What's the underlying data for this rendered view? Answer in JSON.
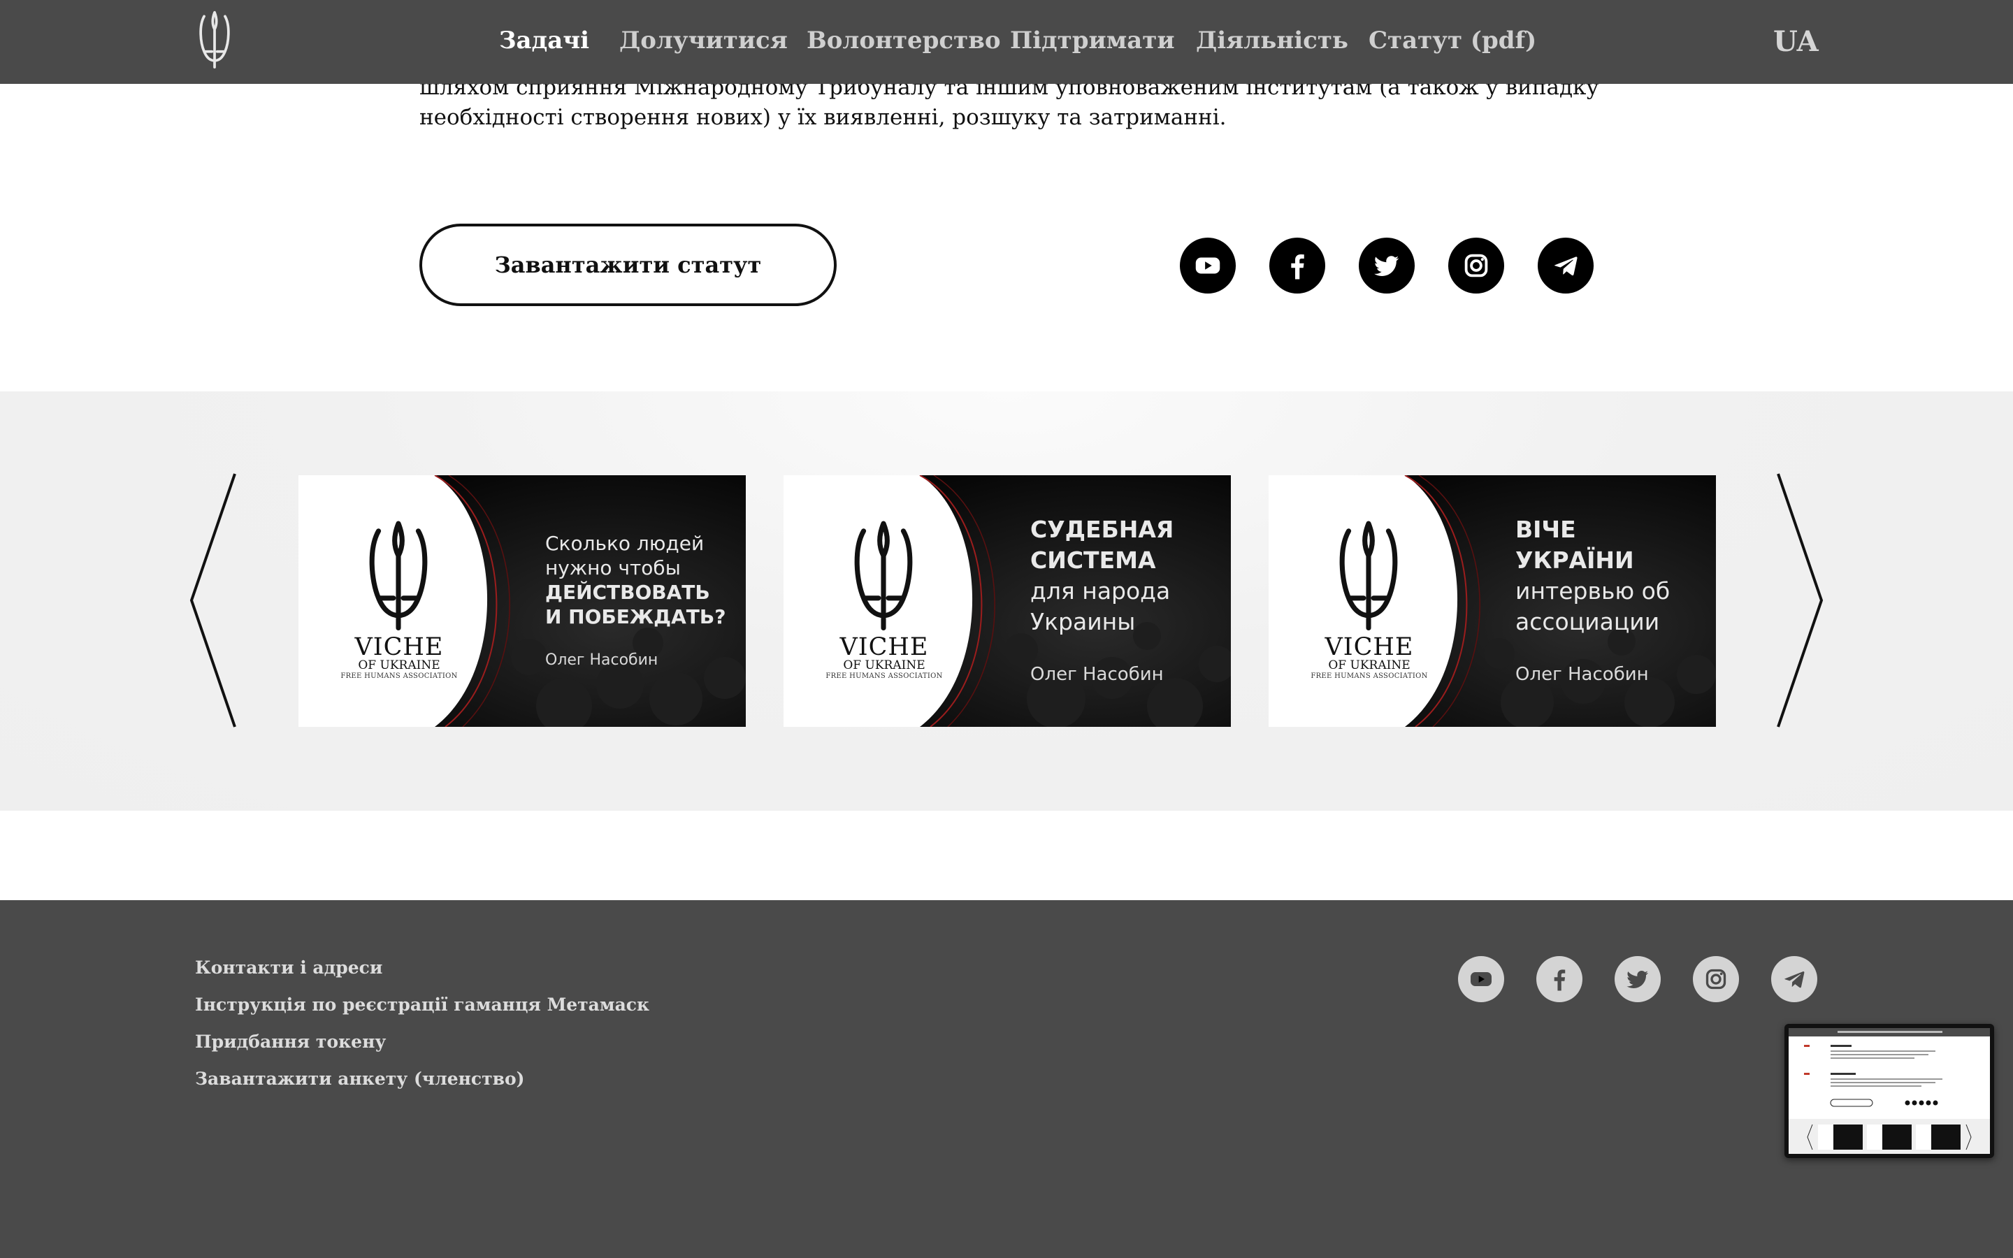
{
  "nav": {
    "items": [
      {
        "label": "Задачі",
        "active": true
      },
      {
        "label": "Долучитися",
        "active": false
      },
      {
        "label": "Волонтерство",
        "active": false
      },
      {
        "label": "Підтримати",
        "active": false
      },
      {
        "label": "Діяльність",
        "active": false
      },
      {
        "label": "Статут (pdf)",
        "active": false
      }
    ],
    "language": "UA"
  },
  "content": {
    "paragraph_lines": [
      "шляхом сприяння Міжнародному Трибуналу та іншим уповноваженим інститутам (а також у випадку",
      "необхідності створення нових) у їх виявленні, розшуку та затриманні."
    ],
    "download_button": "Завантажити статут",
    "social_icons": [
      "youtube-icon",
      "facebook-icon",
      "twitter-icon",
      "instagram-icon",
      "telegram-icon"
    ]
  },
  "carousel": {
    "cards": [
      {
        "lines": [
          {
            "text": "Сколько людей",
            "bold": false
          },
          {
            "text": "нужно чтобы",
            "bold": false
          },
          {
            "text": "ДЕЙСТВОВАТЬ",
            "bold": true
          },
          {
            "text": "И ПОБЕЖДАТЬ?",
            "bold": true
          }
        ],
        "author": "Олег Насобин",
        "brand": {
          "name": "VICHE",
          "sub": "OF UKRAINE",
          "tag": "FREE HUMANS ASSOCIATION"
        }
      },
      {
        "lines": [
          {
            "text": "СУДЕБНАЯ",
            "bold": true
          },
          {
            "text": "СИСТЕМА",
            "bold": true
          },
          {
            "text": "для народа",
            "bold": false
          },
          {
            "text": "Украины",
            "bold": false
          }
        ],
        "author": "Олег Насобин",
        "brand": {
          "name": "VICHE",
          "sub": "OF UKRAINE",
          "tag": "FREE HUMANS ASSOCIATION"
        }
      },
      {
        "lines": [
          {
            "text": "ВІЧЕ",
            "bold": true
          },
          {
            "text": "УКРАЇНИ",
            "bold": true
          },
          {
            "text": "интервью об",
            "bold": false
          },
          {
            "text": "ассоциации",
            "bold": false
          }
        ],
        "author": "Олег Насобин",
        "brand": {
          "name": "VICHE",
          "sub": "OF UKRAINE",
          "tag": "FREE HUMANS ASSOCIATION"
        }
      }
    ]
  },
  "footer": {
    "links": [
      "Контакти і адреси",
      "Інструкція по реєстрації гаманця Метамаск",
      "Придбання токену",
      "Завантажити анкету (членство)"
    ],
    "social_icons": [
      "youtube-icon",
      "facebook-icon",
      "twitter-icon",
      "instagram-icon",
      "telegram-icon"
    ]
  },
  "thumbnail": {
    "icon": "page-preview-thumbnail"
  },
  "colors": {
    "header_bg": "#4a4a4a",
    "footer_bg": "#4a4a4a",
    "band_bg": "#f0f0f0",
    "card_accent": "#c0392b"
  }
}
